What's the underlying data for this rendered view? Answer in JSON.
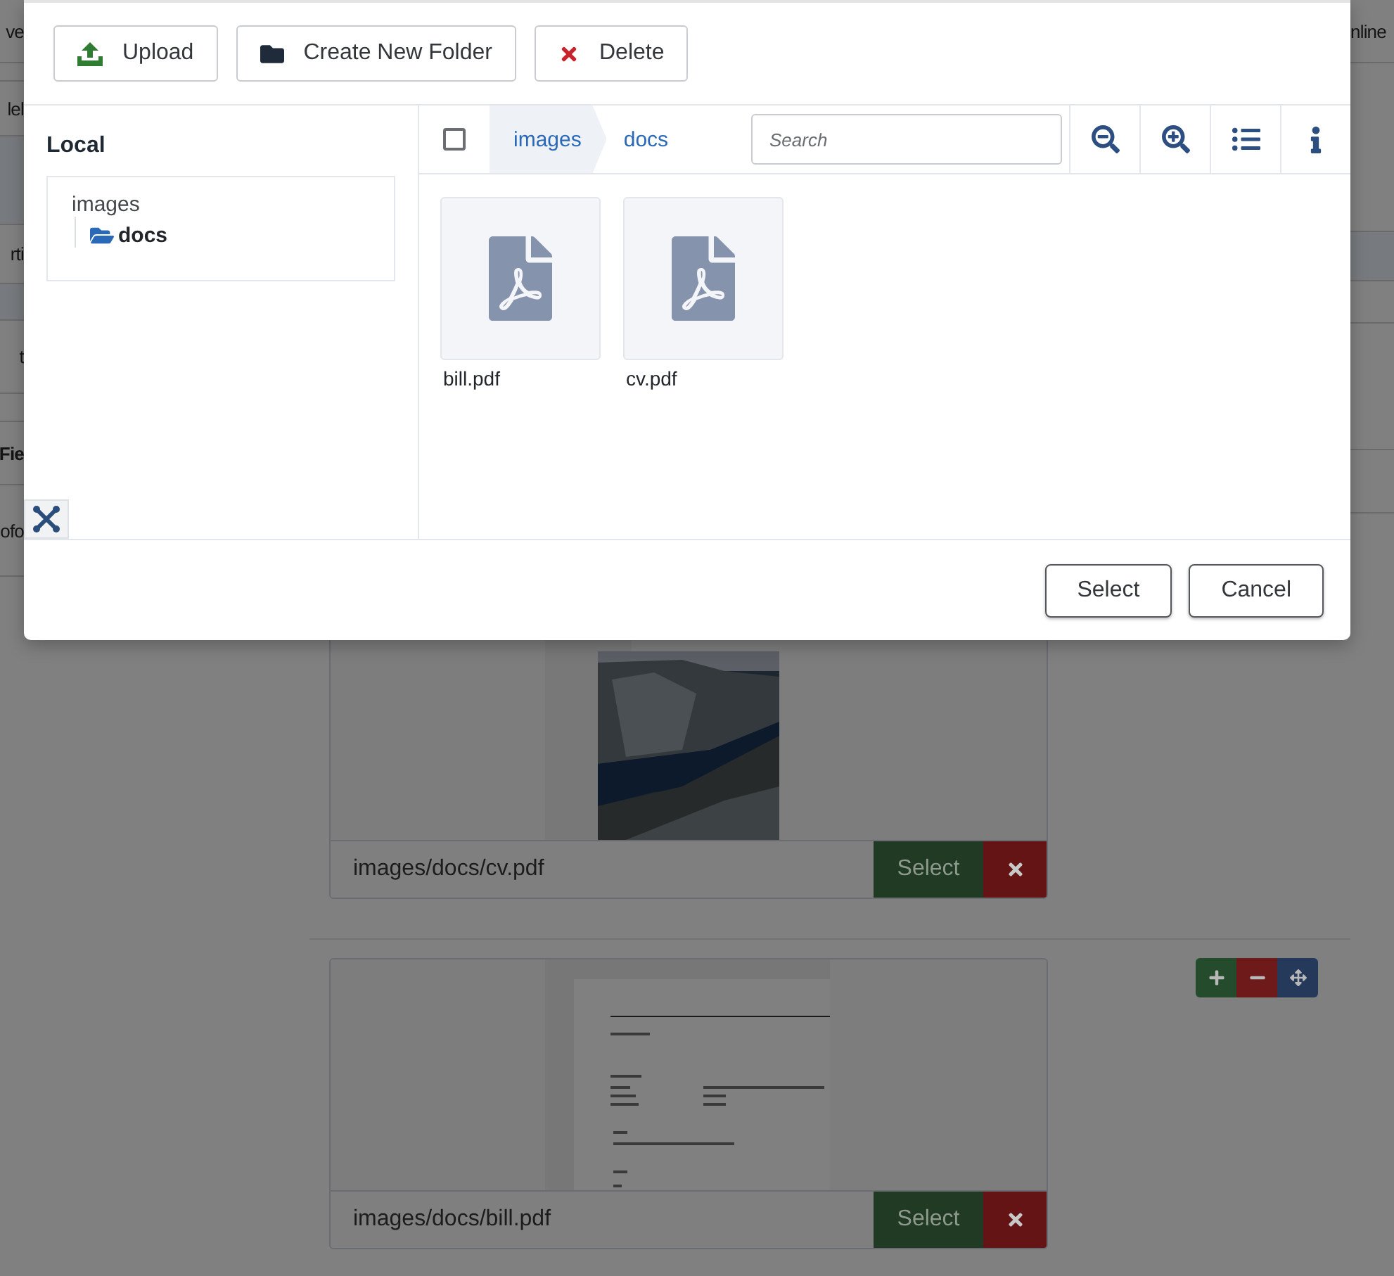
{
  "background": {
    "left_strip": [
      "ve",
      "lel",
      "rti",
      "t",
      "Fie",
      "ofo"
    ],
    "right_strip": [
      "nline"
    ],
    "media_fields": [
      {
        "path": "images/docs/cv.pdf",
        "select_label": "Select",
        "controls": false
      },
      {
        "preview": {
          "kind": "document"
        },
        "path": "images/docs/bill.pdf",
        "select_label": "Select",
        "controls": true
      }
    ]
  },
  "modal": {
    "toolbar": [
      {
        "kind": "upload",
        "label": "Upload"
      },
      {
        "kind": "folder",
        "label": "Create New Folder"
      },
      {
        "kind": "delete",
        "label": "Delete"
      }
    ],
    "sidebar": {
      "title": "Local",
      "tree": [
        {
          "label": "images",
          "selected": false,
          "children": [
            {
              "label": "docs",
              "selected": true
            }
          ]
        }
      ]
    },
    "select_all": {
      "checked": false
    },
    "breadcrumb": [
      "images",
      "docs"
    ],
    "search": {
      "placeholder": "Search"
    },
    "files": [
      {
        "name": "bill.pdf",
        "selected": false
      },
      {
        "name": "cv.pdf",
        "selected": false
      }
    ],
    "footer": [
      "Select",
      "Cancel"
    ]
  }
}
